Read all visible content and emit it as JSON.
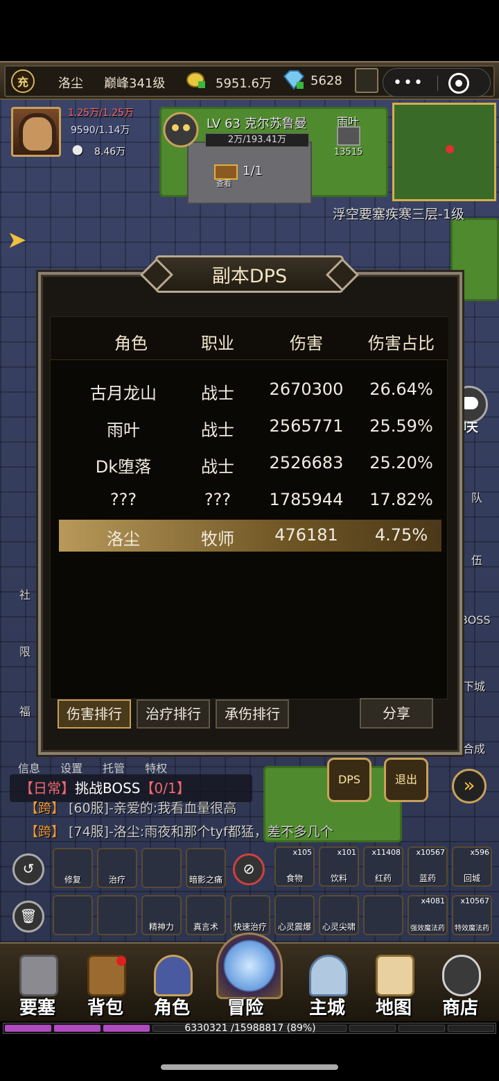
{
  "topbar": {
    "recharge_icon_text": "充",
    "player_name": "洛尘",
    "level": "巅峰341级",
    "gold": "5951.6万",
    "diamonds": "5628",
    "capsule_more": "•••"
  },
  "hero": {
    "hp": "1.25万/1.25万",
    "mp": "9590/1.14万",
    "power": "8.46万"
  },
  "boss": {
    "title": "LV 63 克尔苏鲁曼",
    "hp": "2万/193.41万",
    "count": "1/1",
    "view_label": "查看",
    "teammate_name": "雨叶",
    "teammate_hp": "13515"
  },
  "location": "浮空要塞疾寒三层-1级",
  "dps_panel": {
    "title": "副本DPS",
    "headers": [
      "角色",
      "职业",
      "伤害",
      "伤害占比"
    ],
    "rows": [
      {
        "name": "古月龙山",
        "class": "战士",
        "damage": "2670300",
        "percent": "26.64%"
      },
      {
        "name": "雨叶",
        "class": "战士",
        "damage": "2565771",
        "percent": "25.59%"
      },
      {
        "name": "Dk堕落",
        "class": "战士",
        "damage": "2526683",
        "percent": "25.20%"
      },
      {
        "name": "???",
        "class": "???",
        "damage": "1785944",
        "percent": "17.82%"
      },
      {
        "name": "洛尘",
        "class": "牧师",
        "damage": "476181",
        "percent": "4.75%"
      }
    ],
    "tabs": [
      "伤害排行",
      "治疗排行",
      "承伤排行"
    ],
    "share": "分享"
  },
  "chat_button": "聊天",
  "side_labels": {
    "left": [
      "社",
      "限",
      "福"
    ],
    "right": [
      "队",
      "伍",
      "BOSS",
      "下城",
      "合成"
    ]
  },
  "menu_row": "信息 设置 托管 特权",
  "quest": {
    "tag": "【日常】",
    "text": "挑战BOSS",
    "progress": "【0/1】"
  },
  "buttons": {
    "dps": "DPS",
    "exit": "退出",
    "next": "»"
  },
  "chat_lines": [
    {
      "channel": "【跨】",
      "text": "[60服]-亲爱的:我看血量很高"
    },
    {
      "channel": "【跨】",
      "text": "[74服]-洛尘:雨夜和那个tyf都猛，差不多几个"
    }
  ],
  "skills_row1": [
    "修复",
    "治疗",
    "",
    "暗影之痛"
  ],
  "items": [
    {
      "label": "食物",
      "count": "x105"
    },
    {
      "label": "饮料",
      "count": "x101"
    },
    {
      "label": "红药",
      "count": "x11408"
    },
    {
      "label": "蓝药",
      "count": "x10567"
    },
    {
      "label": "回城",
      "count": "x596"
    }
  ],
  "skills_row2": [
    "",
    "",
    "精神力",
    "真言术",
    "快速治疗",
    "心灵震爆",
    "心灵尖啸",
    ""
  ],
  "potions": [
    {
      "label": "强效魔法药",
      "count": "x4081"
    },
    {
      "label": "特效魔法药",
      "count": "x10567"
    }
  ],
  "nav": [
    "要塞",
    "背包",
    "角色",
    "冒险",
    "主城",
    "地图",
    "商店"
  ],
  "xp": {
    "text": "6330321 /15988817 (89%)",
    "progress": 0.89
  }
}
